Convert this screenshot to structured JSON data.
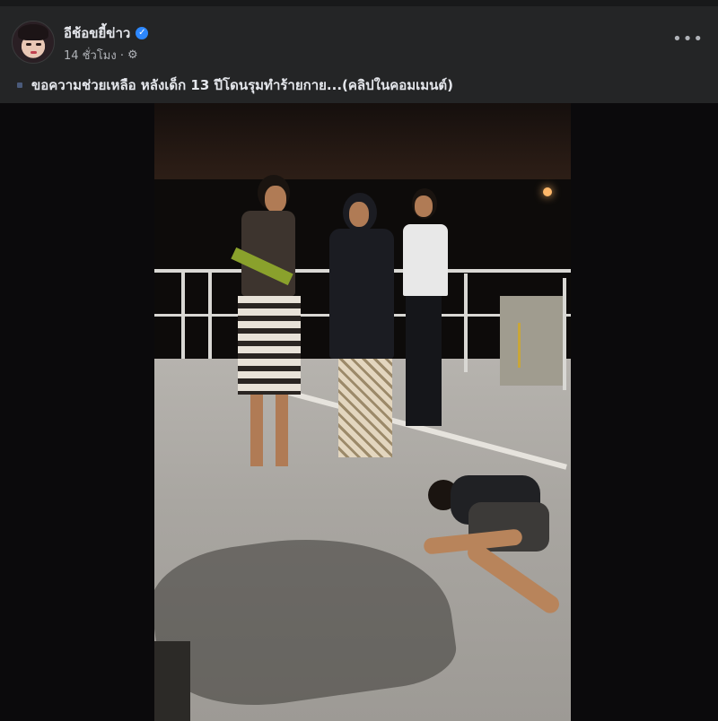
{
  "post": {
    "author": "อีช้อขยี้ข่าว",
    "time": "14 ชั่วโมง ·",
    "caption": "ขอความช่วยเหลือ หลังเด็ก 13 ปีโดนรุมทำร้ายกาย...(คลิปในคอมเมนต์)",
    "more_label": "•••",
    "verified_mark": "✓",
    "gear_mark": "⚙"
  },
  "icons": {
    "verified": "verified-badge-icon",
    "audience": "gear-icon",
    "more": "more-options-icon"
  },
  "colors": {
    "background": "#242526",
    "verified": "#2d88ff"
  }
}
